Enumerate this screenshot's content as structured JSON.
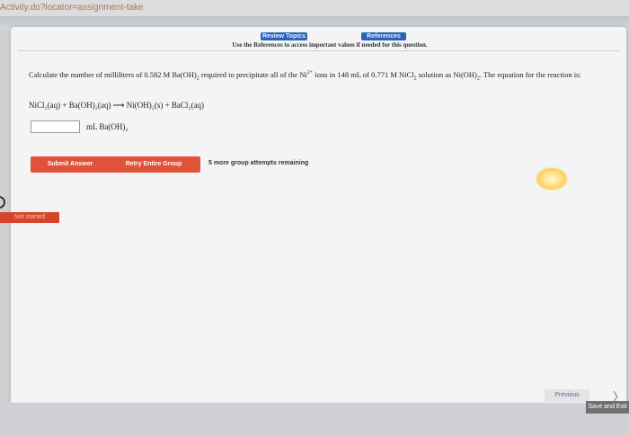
{
  "browser": {
    "url_fragment": "Activity.do?locator=assignment-take"
  },
  "header": {
    "review_topics": "Review Topics",
    "references": "References",
    "hint": "Use the References to access important values if needed for this question."
  },
  "question": {
    "text_part1": "Calculate the number of milliliters of 0.582 M Ba(OH)",
    "text_part2": " required to precipitate all of the Ni",
    "text_part3": " ions in 148 mL of 0.771 M NiCl",
    "text_part4": " solution as Ni(OH)",
    "text_part5": ". The equation for the reaction is:",
    "sub2": "2",
    "sup2plus": "2+"
  },
  "equation": {
    "text": "NiCl₂(aq) + Ba(OH)₂(aq) ⟶ Ni(OH)₂(s) + BaCl₂(aq)"
  },
  "answer": {
    "value": "",
    "unit": "mL Ba(OH)₂"
  },
  "actions": {
    "submit_label": "Submit Answer",
    "retry_label": "Retry Entire Group",
    "attempts_text": "5 more group attempts remaining"
  },
  "status": {
    "label": "Not started"
  },
  "nav": {
    "previous_label": "Previous",
    "next_glyph": "〉",
    "save_label": "Save and Exit"
  },
  "colors": {
    "accent_blue": "#2a63b3",
    "button_red": "#e0523a",
    "status_red": "#d7442c",
    "nav_purple": "#6c5aa8"
  }
}
